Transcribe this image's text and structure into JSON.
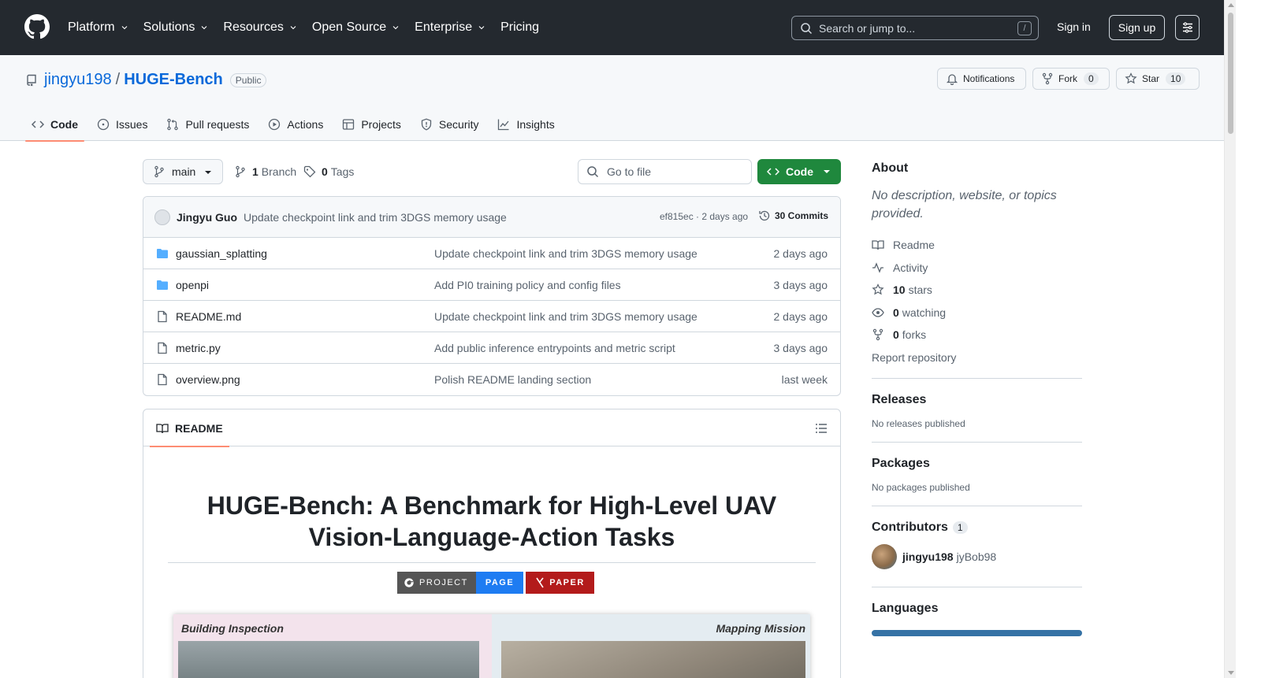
{
  "header": {
    "nav": [
      "Platform",
      "Solutions",
      "Resources",
      "Open Source",
      "Enterprise",
      "Pricing"
    ],
    "search_placeholder": "Search or jump to...",
    "search_shortcut": "/",
    "signin": "Sign in",
    "signup": "Sign up"
  },
  "repo": {
    "owner": "jingyu198",
    "separator": "/",
    "name": "HUGE-Bench",
    "visibility": "Public",
    "notifications_label": "Notifications",
    "fork_label": "Fork",
    "fork_count": "0",
    "star_label": "Star",
    "star_count": "10"
  },
  "tabs": [
    "Code",
    "Issues",
    "Pull requests",
    "Actions",
    "Projects",
    "Security",
    "Insights"
  ],
  "toolbar": {
    "branch": "main",
    "branch_count": "1",
    "branch_label": "Branch",
    "tag_count": "0",
    "tag_label": "Tags",
    "goto_placeholder": "Go to file",
    "code_button": "Code"
  },
  "latest_commit": {
    "author": "Jingyu Guo",
    "message": "Update checkpoint link and trim 3DGS memory usage",
    "meta": "ef815ec · 2 days ago",
    "commits": "30 Commits"
  },
  "files": [
    {
      "type": "dir",
      "name": "gaussian_splatting",
      "message": "Update checkpoint link and trim 3DGS memory usage",
      "date": "2 days ago"
    },
    {
      "type": "dir",
      "name": "openpi",
      "message": "Add PI0 training policy and config files",
      "date": "3 days ago"
    },
    {
      "type": "file",
      "name": "README.md",
      "message": "Update checkpoint link and trim 3DGS memory usage",
      "date": "2 days ago"
    },
    {
      "type": "file",
      "name": "metric.py",
      "message": "Add public inference entrypoints and metric script",
      "date": "3 days ago"
    },
    {
      "type": "file",
      "name": "overview.png",
      "message": "Polish README landing section",
      "date": "last week"
    }
  ],
  "readme": {
    "tab_label": "README",
    "title": "HUGE-Bench: A Benchmark for High-Level UAV Vision-Language-Action Tasks",
    "badge_project_left": "PROJECT",
    "badge_project_right": "PAGE",
    "badge_paper": "PAPER",
    "overview_left_label": "Building Inspection",
    "overview_right_label": "Mapping Mission"
  },
  "about": {
    "title": "About",
    "description": "No description, website, or topics provided.",
    "readme": "Readme",
    "activity": "Activity",
    "stars_count": "10",
    "stars_label": "stars",
    "watching_count": "0",
    "watching_label": "watching",
    "forks_count": "0",
    "forks_label": "forks",
    "report": "Report repository"
  },
  "releases": {
    "title": "Releases",
    "empty": "No releases published"
  },
  "packages": {
    "title": "Packages",
    "empty": "No packages published"
  },
  "contributors": {
    "title": "Contributors",
    "count": "1",
    "name": "jingyu198",
    "login": "jyBob98"
  },
  "languages": {
    "title": "Languages"
  },
  "colors": {
    "header_bg": "#24292f",
    "link": "#0969da",
    "primary_green": "#1f883d",
    "tab_underline": "#fd8c73",
    "folder": "#54aeff",
    "badge_project": "#1e7cf2",
    "badge_paper": "#b31b1b",
    "language_bar": "#3572a5"
  },
  "icons": [
    "github-logo-icon",
    "chevron-down-icon",
    "search-icon",
    "hamburger-icon",
    "repo-icon",
    "bell-icon",
    "fork-icon",
    "star-icon",
    "code-icon",
    "issue-icon",
    "pull-request-icon",
    "play-icon",
    "table-icon",
    "shield-icon",
    "graph-icon",
    "branch-icon",
    "tag-icon",
    "history-icon",
    "folder-icon",
    "file-icon",
    "book-icon",
    "list-icon",
    "pulse-icon",
    "eye-icon"
  ]
}
